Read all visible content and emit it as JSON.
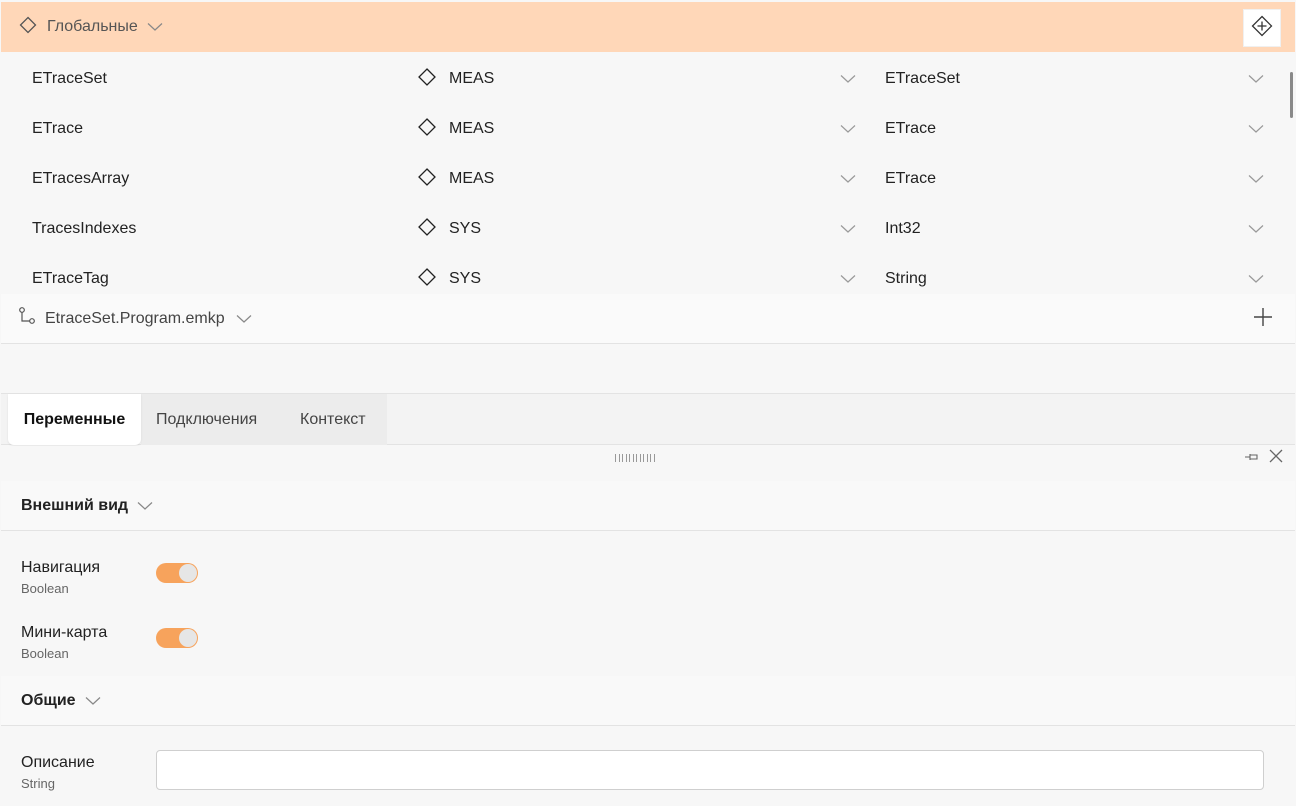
{
  "globals": {
    "title": "Глобальные",
    "variables": [
      {
        "name": "ETraceSet",
        "scope": "MEAS",
        "type": "ETraceSet"
      },
      {
        "name": "ETrace",
        "scope": "MEAS",
        "type": "ETrace"
      },
      {
        "name": "ETracesArray",
        "scope": "MEAS",
        "type": "ETrace"
      },
      {
        "name": "TracesIndexes",
        "scope": "SYS",
        "type": "Int32"
      },
      {
        "name": "ETraceTag",
        "scope": "SYS",
        "type": "String"
      }
    ]
  },
  "program": {
    "title": "EtraceSet.Program.emkp"
  },
  "tabs": [
    {
      "label": "Переменные",
      "active": true
    },
    {
      "label": "Подключения",
      "active": false
    },
    {
      "label": "Контекст",
      "active": false
    }
  ],
  "properties": {
    "appearance": {
      "title": "Внешний вид",
      "navigation": {
        "label": "Навигация",
        "type": "Boolean",
        "value": true
      },
      "minimap": {
        "label": "Мини-карта",
        "type": "Boolean",
        "value": true
      }
    },
    "general": {
      "title": "Общие",
      "description": {
        "label": "Описание",
        "type": "String",
        "value": "",
        "placeholder": ""
      }
    }
  },
  "colors": {
    "globals_header_bg": "#ffd7b8",
    "toggle_on": "#f7a35c",
    "background": "#f7f7f7"
  },
  "icons": [
    "diamond-icon",
    "chevron-down-icon",
    "add-diamond-icon",
    "branch-icon",
    "plus-icon",
    "pin-icon",
    "close-icon",
    "grip-icon"
  ]
}
